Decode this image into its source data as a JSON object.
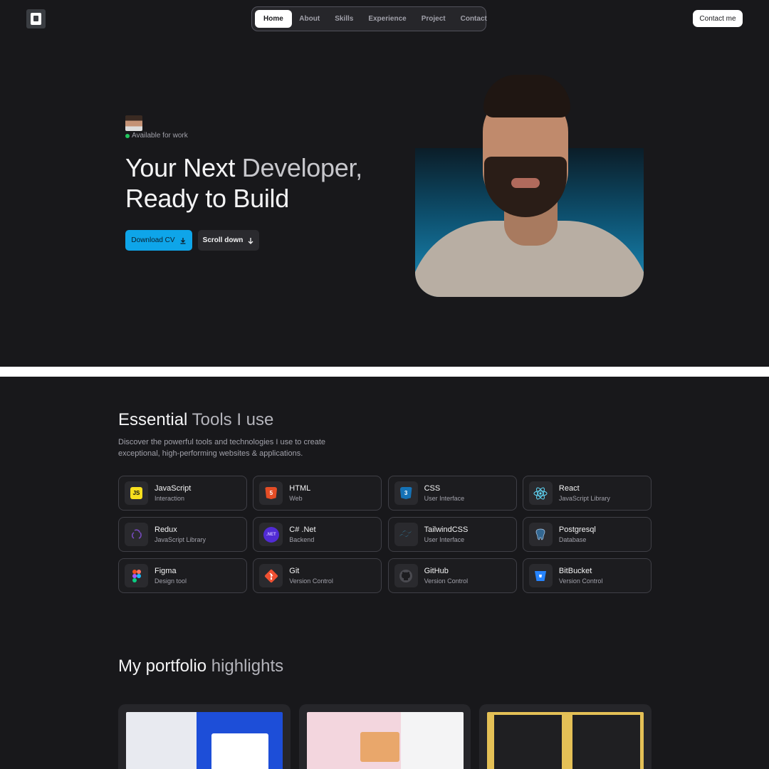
{
  "nav": {
    "items": [
      {
        "label": "Home",
        "active": true
      },
      {
        "label": "About"
      },
      {
        "label": "Skills"
      },
      {
        "label": "Experience"
      },
      {
        "label": "Project"
      },
      {
        "label": "Contact"
      }
    ],
    "contact_label": "Contact me"
  },
  "hero": {
    "status": "Available for work",
    "title_line1_a": "Your Next ",
    "title_line1_b": "Developer,",
    "title_line2": "Ready to Build",
    "download_label": "Download CV",
    "scroll_label": "Scroll down"
  },
  "tools": {
    "title_a": "Essential ",
    "title_b": "Tools I use",
    "description": "Discover the powerful tools and technologies I use to create exceptional, high-performing websites & applications.",
    "items": [
      {
        "name": "JavaScript",
        "sub": "Interaction",
        "icon": "javascript-icon",
        "color": "#f7df1e"
      },
      {
        "name": "HTML",
        "sub": "Web",
        "icon": "html-icon",
        "color": "#e44d26"
      },
      {
        "name": "CSS",
        "sub": "User Interface",
        "icon": "css-icon",
        "color": "#1572b6"
      },
      {
        "name": "React",
        "sub": "JavaScript Library",
        "icon": "react-icon",
        "color": "#61dafb"
      },
      {
        "name": "Redux",
        "sub": "JavaScript Library",
        "icon": "redux-icon",
        "color": "#764abc"
      },
      {
        "name": "C# .Net",
        "sub": "Backend",
        "icon": "dotnet-icon",
        "color": "#512bd4"
      },
      {
        "name": "TailwindCSS",
        "sub": "User Interface",
        "icon": "tailwind-icon",
        "color": "#38bdf8"
      },
      {
        "name": "Postgresql",
        "sub": "Database",
        "icon": "postgresql-icon",
        "color": "#336791"
      },
      {
        "name": "Figma",
        "sub": "Design tool",
        "icon": "figma-icon",
        "color": "#f24e1e"
      },
      {
        "name": "Git",
        "sub": "Version Control",
        "icon": "git-icon",
        "color": "#f05032"
      },
      {
        "name": "GitHub",
        "sub": "Version Control",
        "icon": "github-icon",
        "color": "#3a3a3f"
      },
      {
        "name": "BitBucket",
        "sub": "Version Control",
        "icon": "bitbucket-icon",
        "color": "#2684ff"
      }
    ]
  },
  "portfolio": {
    "title_a": "My portfolio ",
    "title_b": "highlights"
  }
}
